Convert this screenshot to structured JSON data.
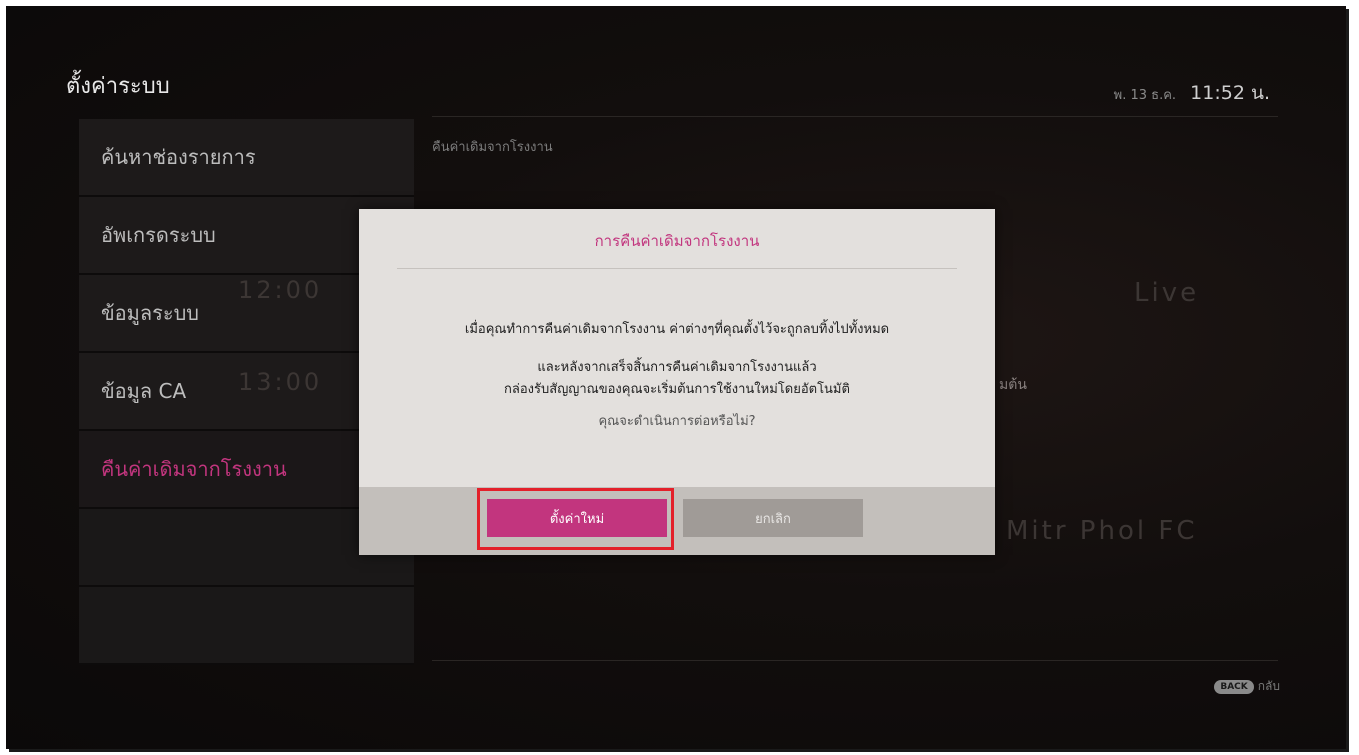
{
  "header": {
    "title": "ตั้งค่าระบบ",
    "date": "พ. 13 ธ.ค.",
    "time": "11:52 น."
  },
  "sidebar": {
    "items": [
      {
        "label": "ค้นหาช่องรายการ"
      },
      {
        "label": "อัพเกรดระบบ"
      },
      {
        "label": "ข้อมูลระบบ"
      },
      {
        "label": "ข้อมูล CA"
      },
      {
        "label": "คืนค่าเดิมจากโรงงาน"
      }
    ]
  },
  "breadcrumb": "คืนค่าเดิมจากโรงงาน",
  "background_text": {
    "schedule_1": "12:00",
    "schedule_2": "13:00",
    "live": "Live",
    "team": "Mitr Phol FC",
    "partial": "มต้น"
  },
  "dialog": {
    "title": "การคืนค่าเดิมจากโรงงาน",
    "message_1": "เมื่อคุณทำการคืนค่าเดิมจากโรงงาน ค่าต่างๆที่คุณตั้งไว้จะถูกลบทิ้งไปทั้งหมด",
    "message_2": "และหลังจากเสร็จสิ้นการคืนค่าเดิมจากโรงงานแล้ว",
    "message_3": "กล่องรับสัญญาณของคุณจะเริ่มต้นการใช้งานใหม่โดยอัตโนมัติ",
    "question": "คุณจะดำเนินการต่อหรือไม่?",
    "confirm_label": "ตั้งค่าใหม่",
    "cancel_label": "ยกเลิก"
  },
  "footer": {
    "back_key": "BACK",
    "back_label": "กลับ"
  },
  "colors": {
    "accent": "#c2357e",
    "highlight": "#e3202a"
  }
}
